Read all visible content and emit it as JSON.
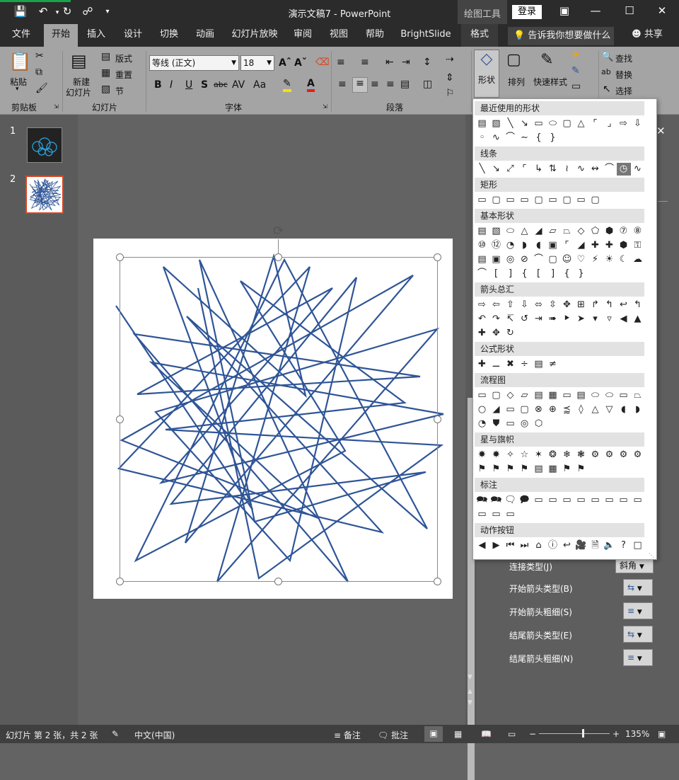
{
  "title_bar": {
    "doc_title": "演示文稿7  -  PowerPoint",
    "context_tab": "绘图工具",
    "login": "登录",
    "save_icon": "save-icon",
    "undo_icon": "undo-icon",
    "redo_icon": "repeat-icon"
  },
  "tabs": [
    {
      "label": "文件"
    },
    {
      "label": "开始"
    },
    {
      "label": "插入"
    },
    {
      "label": "设计"
    },
    {
      "label": "切换"
    },
    {
      "label": "动画"
    },
    {
      "label": "幻灯片放映"
    },
    {
      "label": "审阅"
    },
    {
      "label": "视图"
    },
    {
      "label": "帮助"
    },
    {
      "label": "BrightSlide"
    },
    {
      "label": "格式"
    }
  ],
  "tell_me": "告诉我你想要做什么",
  "share": "共享",
  "ribbon": {
    "clipboard": {
      "paste": "粘贴",
      "group": "剪贴板"
    },
    "slides": {
      "new_slide": "新建",
      "new_slide2": "幻灯片",
      "layout": "版式",
      "reset": "重置",
      "section": "节",
      "group": "幻灯片"
    },
    "font": {
      "font_name": "等线 (正文)",
      "font_size": "18",
      "group": "字体"
    },
    "paragraph": {
      "group": "段落"
    },
    "drawing": {
      "shapes": "形状",
      "arrange": "排列",
      "quick_styles": "快速样式"
    },
    "editing": {
      "find": "查找",
      "replace": "替换",
      "select": "选择"
    }
  },
  "thumbnails": [
    {
      "num": "1"
    },
    {
      "num": "2"
    }
  ],
  "shapes_panel": {
    "categories": [
      {
        "label": "最近使用的形状"
      },
      {
        "label": "线条"
      },
      {
        "label": "矩形"
      },
      {
        "label": "基本形状"
      },
      {
        "label": "箭头总汇"
      },
      {
        "label": "公式形状"
      },
      {
        "label": "流程图"
      },
      {
        "label": "星与旗帜"
      },
      {
        "label": "标注"
      },
      {
        "label": "动作按钮"
      }
    ]
  },
  "format_pane": {
    "join_type": {
      "label": "连接类型(J)",
      "value": "斜角"
    },
    "begin_arrow_type": {
      "label": "开始箭头类型(B)"
    },
    "begin_arrow_size": {
      "label": "开始箭头粗细(S)"
    },
    "end_arrow_type": {
      "label": "结尾箭头类型(E)"
    },
    "end_arrow_size": {
      "label": "结尾箭头粗细(N)"
    }
  },
  "status": {
    "slide_info": "幻灯片 第 2 张，共 2 张",
    "language": "中文(中国)",
    "notes": "备注",
    "comments": "批注",
    "zoom": "135%",
    "zoom_level": 0.62
  },
  "colors": {
    "accent": "#d24726",
    "line": "#2f5597"
  }
}
